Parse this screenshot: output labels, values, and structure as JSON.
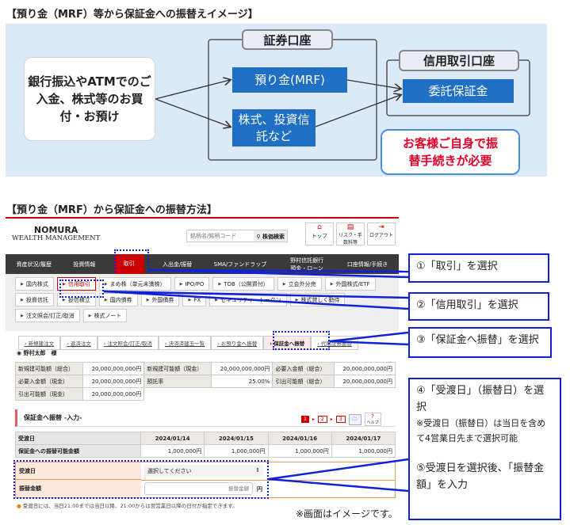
{
  "title1": "【預り金（MRF）等から保証金への振替えイメージ】",
  "diagram": {
    "source": "銀行振込やATMでのご入金、株式等のお買付・お預け",
    "securities_account": "証券口座",
    "mrf": "預り金(MRF)",
    "stocks": "株式、投資信託など",
    "margin_account": "信用取引口座",
    "margin_deposit": "委託保証金",
    "callout": "お客様ご自身で振替手続きが必要"
  },
  "title2": "【預り金（MRF）から保証金への振替方法】",
  "screen": {
    "logo_top": "NOMURA",
    "logo_bottom": "WEALTH MANAGEMENT",
    "search_placeholder": "銘柄名/銘柄コード",
    "search_button": "株価検索",
    "icons": [
      {
        "label": "トップ",
        "icon": "home-icon"
      },
      {
        "label": "リスク・手数料等",
        "icon": "document-icon"
      },
      {
        "label": "ログアウト",
        "icon": "logout-icon"
      }
    ],
    "nav": [
      "資産状況/履歴",
      "投資情報",
      "取引",
      "入出金/振替",
      "SMA/ファンドラップ",
      "野村信託銀行 預金・ローン",
      "口座情報/手続き"
    ],
    "subnav": [
      "国内株式",
      "信用取引",
      "まめ株（単元未満株）",
      "IPO/PO",
      "TOB（公開買付）",
      "立会外分売",
      "外国株式/ETF",
      "投資信託",
      "投信積立",
      "国内債券",
      "外国債券",
      "FX",
      "セキュリティ・トークン",
      "株式貸しく勤待",
      "注文照会/訂正/取消",
      "株式ノート"
    ],
    "tabs": [
      "新規建注文",
      "返済注文",
      "注文照会/訂正/取消",
      "決済済建玉一覧",
      "お預り金へ振替",
      "保証金へ振替",
      "代用証券振替"
    ],
    "user": "野村太郎　様",
    "summary": [
      [
        "新規建可能額（総合）",
        "20,000,000,000円",
        "新規建可能額（現金）",
        "20,000,000,000円",
        "必要入金額（総合）",
        "20,000,000,000円"
      ],
      [
        "必要入金額（現金）",
        "20,000,000,000円",
        "預託率",
        "25.00%",
        "引出可能額（総合）",
        "20,000,000,000円"
      ],
      [
        "引出可能額（現金）",
        "20,000,000,000円"
      ]
    ],
    "section_title": "保証金へ振替 -入力-",
    "steps": [
      "1",
      "2",
      "3"
    ],
    "help": "ヘルプ",
    "table_header": [
      "受渡日",
      "2024/01/14",
      "2024/01/15",
      "2024/01/16",
      "2024/01/17"
    ],
    "table_row": [
      "保証金への振替可能金額",
      "1,000,000円",
      "1,000,000円",
      "1,000,000円",
      "1,000,000円"
    ],
    "form": {
      "date_label": "受渡日",
      "date_value": "選択してください",
      "amount_label": "振替金額",
      "amount_placeholder": "振替金額",
      "unit": "円"
    },
    "note": "受渡日には、当日21:00までは当日以降、21:00からは翌営業日以降の日付が指定できます。"
  },
  "image_note": "※画面はイメージです。",
  "annotations": {
    "a1": "①「取引」を選択",
    "a2": "②「信用取引」を選択",
    "a3": "③「保証金へ振替」を選択",
    "a4": "④「受渡日」（振替日）を選択",
    "a4_note": "※受渡日（振替日）は当日を含めて4営業日先まで選択可能",
    "a5": "⑤受渡日を選択後、「振替金額」を入力"
  }
}
